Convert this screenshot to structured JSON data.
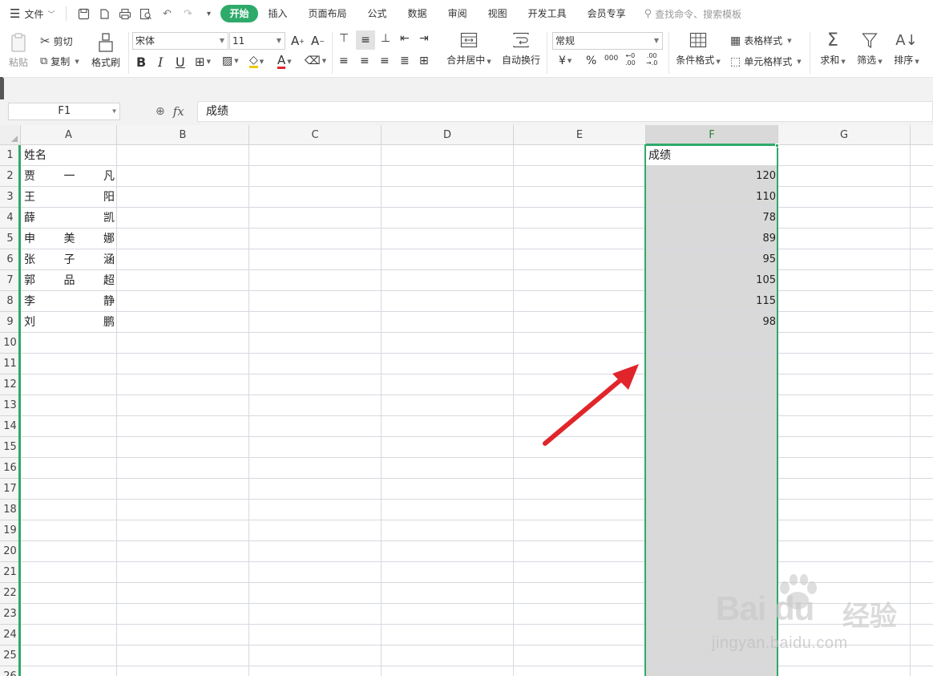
{
  "menubar": {
    "menu_icon": "hamburger-icon",
    "file_label": "文件",
    "tabs": [
      "开始",
      "插入",
      "页面布局",
      "公式",
      "数据",
      "审阅",
      "视图",
      "开发工具",
      "会员专享"
    ],
    "active_tab": "开始",
    "search_placeholder": "查找命令、搜索模板"
  },
  "ribbon": {
    "paste_label": "粘贴",
    "cut_label": "剪切",
    "copy_label": "复制",
    "format_painter_label": "格式刷",
    "font_name": "宋体",
    "font_size": "11",
    "merge_center_label": "合并居中",
    "wrap_text_label": "自动换行",
    "number_format": "常规",
    "conditional_format_label": "条件格式",
    "table_style_label": "表格样式",
    "cell_style_label": "单元格样式",
    "sum_label": "求和",
    "filter_label": "筛选",
    "sort_label": "排序"
  },
  "formula_bar": {
    "name_box": "F1",
    "fx_label": "fx",
    "formula": "成绩"
  },
  "sheet": {
    "columns": [
      "A",
      "B",
      "C",
      "D",
      "E",
      "F",
      "G"
    ],
    "selected_column": "F",
    "row_numbers": [
      "1",
      "2",
      "3",
      "4",
      "5",
      "6",
      "7",
      "8",
      "9",
      "10",
      "11",
      "12",
      "13",
      "14",
      "15",
      "16",
      "17",
      "18",
      "19",
      "20",
      "21",
      "22",
      "23",
      "24",
      "25",
      "26"
    ],
    "A1": "姓名",
    "F1": "成绩",
    "names": [
      [
        "贾",
        "一",
        "凡"
      ],
      [
        "王",
        "",
        "阳"
      ],
      [
        "薛",
        "",
        "凯"
      ],
      [
        "申",
        "美",
        "娜"
      ],
      [
        "张",
        "子",
        "涵"
      ],
      [
        "郭",
        "品",
        "超"
      ],
      [
        "李",
        "",
        "静"
      ],
      [
        "刘",
        "",
        "鹏"
      ]
    ],
    "scores": [
      "120",
      "110",
      "78",
      "89",
      "95",
      "105",
      "115",
      "98"
    ]
  },
  "colors": {
    "accent": "#2eaa6a",
    "selection_fill": "#d9d9d9",
    "arrow": "#e0252b"
  },
  "watermark": {
    "logo": "Bai du",
    "cn": "经验",
    "url": "jingyan.baidu.com"
  }
}
